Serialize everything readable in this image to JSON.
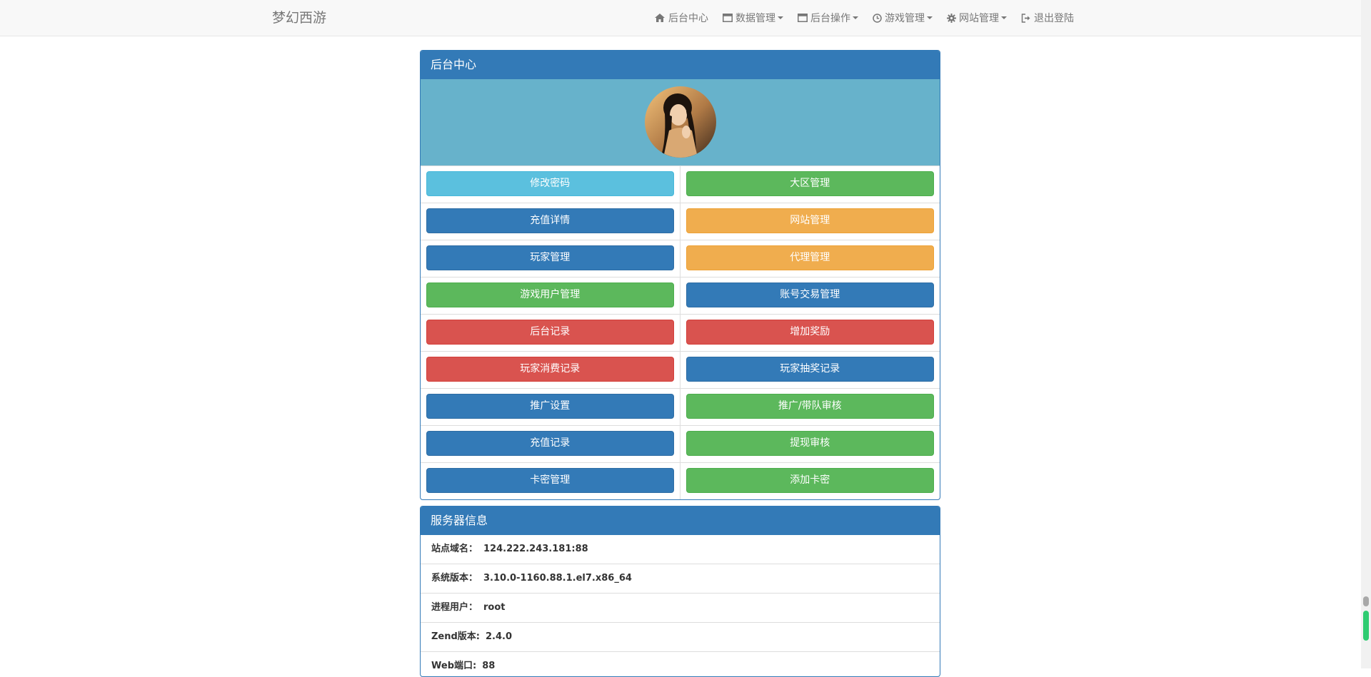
{
  "navbar": {
    "brand": "梦幻西游",
    "items": [
      {
        "label": "后台中心",
        "icon": "home-icon",
        "dropdown": false
      },
      {
        "label": "数据管理",
        "icon": "window-icon",
        "dropdown": true
      },
      {
        "label": "后台操作",
        "icon": "window-icon",
        "dropdown": true
      },
      {
        "label": "游戏管理",
        "icon": "clock-icon",
        "dropdown": true
      },
      {
        "label": "网站管理",
        "icon": "gear-icon",
        "dropdown": true
      },
      {
        "label": "退出登陆",
        "icon": "logout-icon",
        "dropdown": false
      }
    ]
  },
  "admin_panel": {
    "title": "后台中心",
    "avatar": "user-avatar",
    "rows": [
      [
        {
          "label": "修改密码",
          "style": "info"
        },
        {
          "label": "大区管理",
          "style": "success"
        }
      ],
      [
        {
          "label": "充值详情",
          "style": "primary"
        },
        {
          "label": "网站管理",
          "style": "warning"
        }
      ],
      [
        {
          "label": "玩家管理",
          "style": "primary"
        },
        {
          "label": "代理管理",
          "style": "warning"
        }
      ],
      [
        {
          "label": "游戏用户管理",
          "style": "success"
        },
        {
          "label": "账号交易管理",
          "style": "primary"
        }
      ],
      [
        {
          "label": "后台记录",
          "style": "danger"
        },
        {
          "label": "增加奖励",
          "style": "danger"
        }
      ],
      [
        {
          "label": "玩家消费记录",
          "style": "danger"
        },
        {
          "label": "玩家抽奖记录",
          "style": "primary"
        }
      ],
      [
        {
          "label": "推广设置",
          "style": "primary"
        },
        {
          "label": "推广/带队审核",
          "style": "success"
        }
      ],
      [
        {
          "label": "充值记录",
          "style": "primary"
        },
        {
          "label": "提现审核",
          "style": "success"
        }
      ],
      [
        {
          "label": "卡密管理",
          "style": "primary"
        },
        {
          "label": "添加卡密",
          "style": "success"
        }
      ]
    ]
  },
  "server_panel": {
    "title": "服务器信息",
    "rows": [
      {
        "label": "站点域名：",
        "value": "124.222.243.181:88"
      },
      {
        "label": "系统版本：",
        "value": "3.10.0-1160.88.1.el7.x86_64"
      },
      {
        "label": "进程用户：",
        "value": "root"
      },
      {
        "label": "Zend版本:",
        "value": "2.4.0"
      },
      {
        "label": "Web端口:",
        "value": "88"
      }
    ]
  },
  "colors": {
    "primary": "#337ab7",
    "info": "#5bc0de",
    "success": "#5cb85c",
    "warning": "#f0ad4e",
    "danger": "#d9534f",
    "profile_bg": "#67b2cb"
  }
}
